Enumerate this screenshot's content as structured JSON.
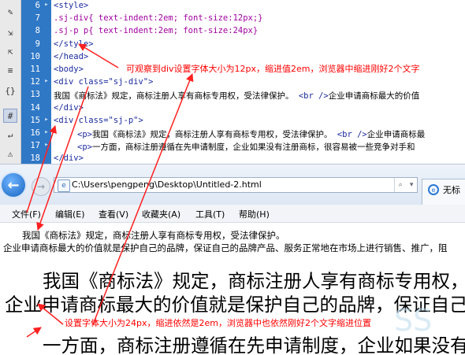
{
  "editor": {
    "toolbar_icons": [
      "pin-icon",
      "expand-icon",
      "collapse-icon",
      "braces-icon",
      "comment-icon",
      "wrap-icon",
      "format-icon"
    ],
    "lines": [
      {
        "num": "6",
        "code": "<style>"
      },
      {
        "num": "7",
        "code": ".sj-div{ text-indent:2em; font-size:12px;}"
      },
      {
        "num": "8",
        "code": ".sj-p p{ text-indent:2em; font-size:24px}"
      },
      {
        "num": "9",
        "code": "</style>"
      },
      {
        "num": "10",
        "code": "</head>"
      },
      {
        "num": "11",
        "code": "<body>"
      },
      {
        "num": "12",
        "code": "<div class=\"sj-div\">"
      },
      {
        "num": "13",
        "text": "我国《商标法》规定，商标注册人享有商标专用权，受法律保护。",
        "tag": "<br />",
        "rest": "企业申请商标最大的价值"
      },
      {
        "num": "14",
        "code": "</div>"
      },
      {
        "num": "15",
        "code": "<div class=\"sj-p\">"
      },
      {
        "num": "16",
        "tag1": "<p>",
        "text": "我国《商标法》规定，商标注册人享有商标专用权，受法律保护。",
        "tag": "<br />",
        "rest": "企业申请商标最"
      },
      {
        "num": "17",
        "tag1": "<p>",
        "text": "一方面，商标注册遵循在先申请制度，企业如果没有注册商标，很容易被一些竞争对手和"
      },
      {
        "num": "18",
        "code": "</div>"
      }
    ]
  },
  "browser": {
    "url": "C:\\Users\\pengpeng\\Desktop\\Untitled-2.html",
    "tab_label": "无标",
    "menu": [
      "文件(F)",
      "编辑(E)",
      "查看(V)",
      "收藏夹(A)",
      "工具(T)",
      "帮助(H)"
    ],
    "small_line1": "我国《商标法》规定，商标注册人享有商标专用权，受法律保护。",
    "small_line2": "企业申请商标最大的价值就是保护自己的品牌，保证自己的品牌产品、服务正常地在市场上进行销售、推广，阻",
    "big_line1": "我国《商标法》规定，商标注册人享有商标专用权，",
    "big_line2": "企业申请商标最大的价值就是保护自己的品牌，保证自己",
    "big_line3": "一方面，商标注册遵循在先申请制度，企业如果没有",
    "watermark": "SS"
  },
  "annotations": {
    "note1": "可观察到div设置字体大小为12px，缩进值2em，浏览器中缩进刚好2个文字",
    "note2": "设置字体大小为24px，缩进依然是2em，浏览器中也依然刚好2个文字缩进位置"
  },
  "colors": {
    "annotation": "#ff0000",
    "gutter": "#2f78c6",
    "tag": "#1b2a9e",
    "selector": "#a000a0"
  }
}
